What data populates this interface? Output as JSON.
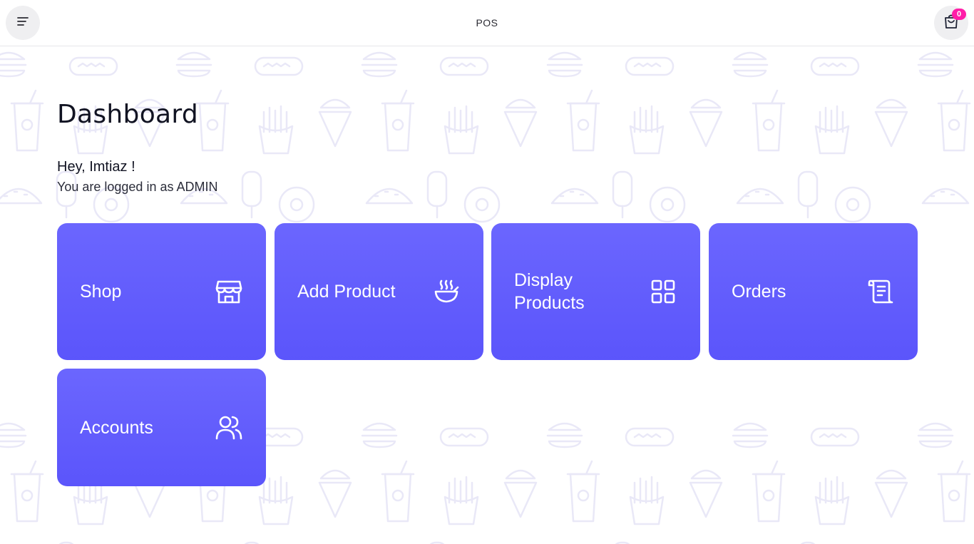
{
  "header": {
    "title": "POS",
    "cart_count": "0",
    "icons": {
      "menu": "menu-lines-icon",
      "cart": "shopping-bag-icon"
    }
  },
  "page": {
    "title": "Dashboard",
    "greeting": "Hey, Imtiaz !",
    "role_text": "You are logged in as ADMIN"
  },
  "tiles": [
    {
      "label": "Shop",
      "icon": "store-icon"
    },
    {
      "label": "Add Product",
      "icon": "soup-bowl-icon"
    },
    {
      "label": "Display Products",
      "icon": "grid-icon"
    },
    {
      "label": "Orders",
      "icon": "receipt-scroll-icon"
    },
    {
      "label": "Accounts",
      "icon": "users-icon"
    }
  ],
  "colors": {
    "accent": "#6360fc",
    "badge": "#ff1ea8",
    "pattern": "#ecebf8"
  }
}
